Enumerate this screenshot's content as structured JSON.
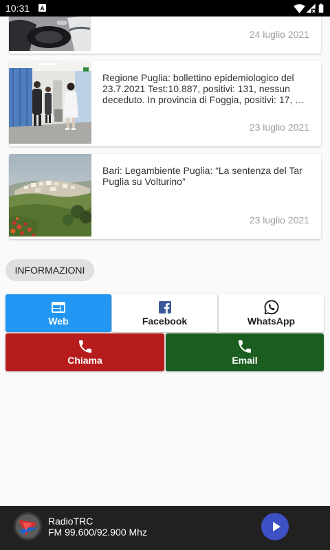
{
  "status_bar": {
    "time": "10:31",
    "notification_icon": "notification-icon",
    "wifi_icon": "wifi-icon",
    "signal_icon": "signal-icon",
    "battery_icon": "battery-icon"
  },
  "articles": [
    {
      "date": "24 luglio 2021"
    },
    {
      "title": "Regione Puglia: bollettino epidemiologico del 23.7.2021 Test:10.887, positivi: 131, nessun deceduto. In provincia di Foggia, positivi: 17, …",
      "date": "23 luglio 2021"
    },
    {
      "title": "Bari: Legambiente Puglia: “La sentenza del Tar Puglia su Volturino”",
      "date": "23 luglio 2021"
    }
  ],
  "info_section": {
    "label": "INFORMAZIONI"
  },
  "contact_buttons": [
    {
      "label": "Web",
      "icon": "web-icon",
      "background": "#2196F3",
      "text_color": "#FFFFFF"
    },
    {
      "label": "Facebook",
      "icon": "facebook-icon",
      "background": "#FFFFFF",
      "text_color": "#212121"
    },
    {
      "label": "WhatsApp",
      "icon": "whatsapp-icon",
      "background": "#FFFFFF",
      "text_color": "#212121"
    },
    {
      "label": "Chiama",
      "icon": "phone-icon",
      "background": "#B71C1C",
      "text_color": "#FFFFFF"
    },
    {
      "label": "Email",
      "icon": "phone-icon",
      "background": "#1B5E20",
      "text_color": "#FFFFFF"
    }
  ],
  "player": {
    "logo_icon": "radiotrc-logo-icon",
    "station_name": "RadioTRC",
    "frequency": "FM 99.600/92.900 Mhz",
    "play_icon": "play-icon",
    "play_button_color": "#3D50C4",
    "background": "#212121"
  },
  "colors": {
    "page_background": "#FAFAFA",
    "status_bar": "#000000",
    "card_background": "#FFFFFF",
    "chip_background": "#E0E0E0",
    "article_title": "#333333",
    "article_date": "#9E9E9E",
    "facebook_blue": "#3B5998"
  }
}
